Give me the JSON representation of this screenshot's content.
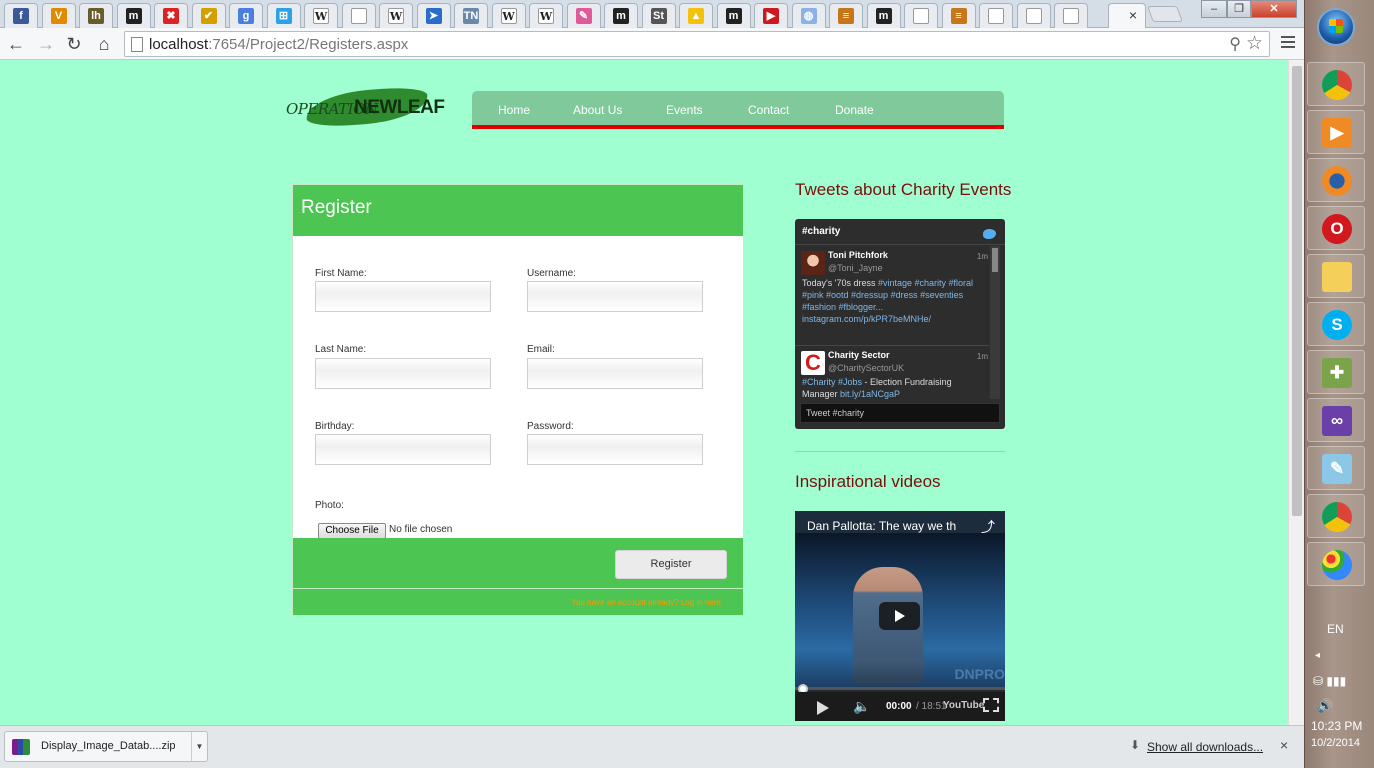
{
  "browser": {
    "tabs": [
      {
        "icon": "facebook-icon",
        "glyph": "f",
        "color": "#3b5998"
      },
      {
        "icon": "v-icon",
        "glyph": "V",
        "color": "#e08a00"
      },
      {
        "icon": "lh-icon",
        "glyph": "lh",
        "color": "#6b5a2a"
      },
      {
        "icon": "m-icon",
        "glyph": "m",
        "color": "#222222"
      },
      {
        "icon": "red-x-icon",
        "glyph": "✖",
        "color": "#d22"
      },
      {
        "icon": "checkmark-icon",
        "glyph": "✔",
        "color": "#d4a000"
      },
      {
        "icon": "google-icon",
        "glyph": "g",
        "color": "#4a7fe0"
      },
      {
        "icon": "windows-icon",
        "glyph": "⊞",
        "color": "#29a3e6"
      },
      {
        "icon": "wikipedia-icon",
        "glyph": "W",
        "color": "#ffffff"
      },
      {
        "icon": "blank-page-icon",
        "glyph": "",
        "color": "#ffffff"
      },
      {
        "icon": "wikipedia-icon",
        "glyph": "W",
        "color": "#ffffff"
      },
      {
        "icon": "bird-icon",
        "glyph": "➤",
        "color": "#2a6cc8"
      },
      {
        "icon": "tn-icon",
        "glyph": "TN",
        "color": "#6a88a8"
      },
      {
        "icon": "wikipedia-icon",
        "glyph": "W",
        "color": "#ffffff"
      },
      {
        "icon": "wikipedia-icon",
        "glyph": "W",
        "color": "#ffffff"
      },
      {
        "icon": "puzzle-icon",
        "glyph": "✎",
        "color": "#e05a9a"
      },
      {
        "icon": "m-icon",
        "glyph": "m",
        "color": "#222222"
      },
      {
        "icon": "st-icon",
        "glyph": "St",
        "color": "#555555"
      },
      {
        "icon": "drive-icon",
        "glyph": "▲",
        "color": "#f4c20d"
      },
      {
        "icon": "m-icon",
        "glyph": "m",
        "color": "#222222"
      },
      {
        "icon": "youtube-icon",
        "glyph": "▶",
        "color": "#cc181e"
      },
      {
        "icon": "globe-icon",
        "glyph": "◍",
        "color": "#8ab2e6"
      },
      {
        "icon": "stack-icon",
        "glyph": "≡",
        "color": "#c8761a"
      },
      {
        "icon": "m-icon",
        "glyph": "m",
        "color": "#222222"
      },
      {
        "icon": "blank-page-icon",
        "glyph": "",
        "color": "#ffffff"
      },
      {
        "icon": "stack-icon",
        "glyph": "≡",
        "color": "#c8761a"
      },
      {
        "icon": "blank-page-icon",
        "glyph": "",
        "color": "#ffffff"
      },
      {
        "icon": "blank-page-icon",
        "glyph": "",
        "color": "#ffffff"
      },
      {
        "icon": "blank-page-icon",
        "glyph": "",
        "color": "#ffffff"
      }
    ],
    "active_tab_close": "×",
    "url_host": "localhost",
    "url_path": ":7654/Project2/Registers.aspx"
  },
  "site": {
    "logo": {
      "part1": "OPERATION",
      "part2": "NEWLEAF"
    },
    "nav": [
      "Home",
      "About Us",
      "Events",
      "Contact",
      "Donate"
    ],
    "register": {
      "title": "Register",
      "first_name_label": "First Name:",
      "username_label": "Username:",
      "last_name_label": "Last Name:",
      "email_label": "Email:",
      "birthday_label": "Birthday:",
      "password_label": "Password:",
      "photo_label": "Photo:",
      "choose_file": "Choose File",
      "no_file": "No file chosen",
      "submit": "Register",
      "login_link": "You have an account already? Log in here"
    },
    "sidebar": {
      "tweets_heading": "Tweets about Charity Events",
      "widget_tag": "#charity",
      "tweets": [
        {
          "name": "Toni Pitchfork",
          "handle": "@Toni_Jayne",
          "time": "1m",
          "text": "Today's '70s dress ",
          "links": "#vintage #charity #floral #pink #ootd #dressup #dress #seventies #fashion #fblogger... instagram.com/p/kPR7beMNHe/"
        },
        {
          "name": "Charity Sector",
          "handle": "@CharitySectorUK",
          "time": "1m",
          "links_a": "#Charity #Jobs",
          "text": " - Election Fundraising Manager ",
          "links_b": "bit.ly/1aNCgaP"
        }
      ],
      "tweet_box": "Tweet #charity",
      "videos_heading": "Inspirational videos",
      "video": {
        "title": "Dan Pallotta: The way we th",
        "current_time": "00:00",
        "duration": "/ 18:51",
        "brand": "YouTube",
        "stage_text": "DNPRO"
      }
    }
  },
  "downloads": {
    "file": "Display_Image_Datab....zip",
    "show_all": "Show all downloads...",
    "close": "×"
  },
  "taskbar": {
    "lang": "EN",
    "time": "10:23 PM",
    "date": "10/2/2014"
  }
}
